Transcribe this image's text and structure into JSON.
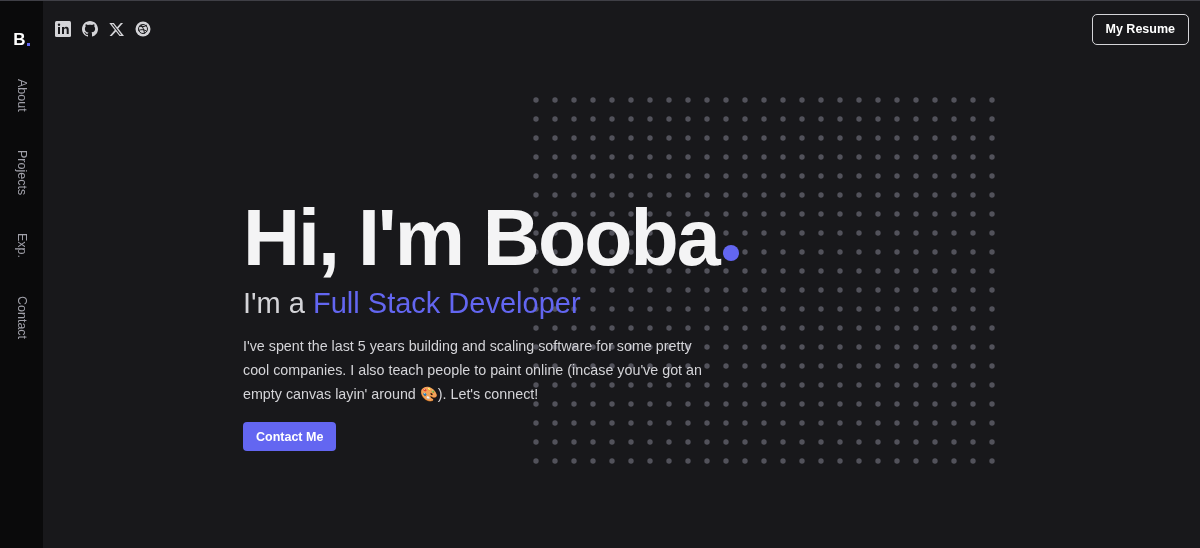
{
  "logo": {
    "letter": "B"
  },
  "social_links": [
    {
      "kind": "linkedin"
    },
    {
      "kind": "github"
    },
    {
      "kind": "x"
    },
    {
      "kind": "dribbble"
    }
  ],
  "resume_button": "My Resume",
  "sidebar": {
    "items": [
      "About",
      "Projects",
      "Exp.",
      "Contact"
    ]
  },
  "hero": {
    "headline": "Hi, I'm Booba",
    "subtitle": "I'm a **Full Stack Developer**",
    "description": "I've spent the last 5 years building and scaling software for some pretty cool companies. I also teach people to paint online (incase you've got an empty canvas layin' around 🎨). Let's connect!",
    "cta": "Contact Me"
  }
}
